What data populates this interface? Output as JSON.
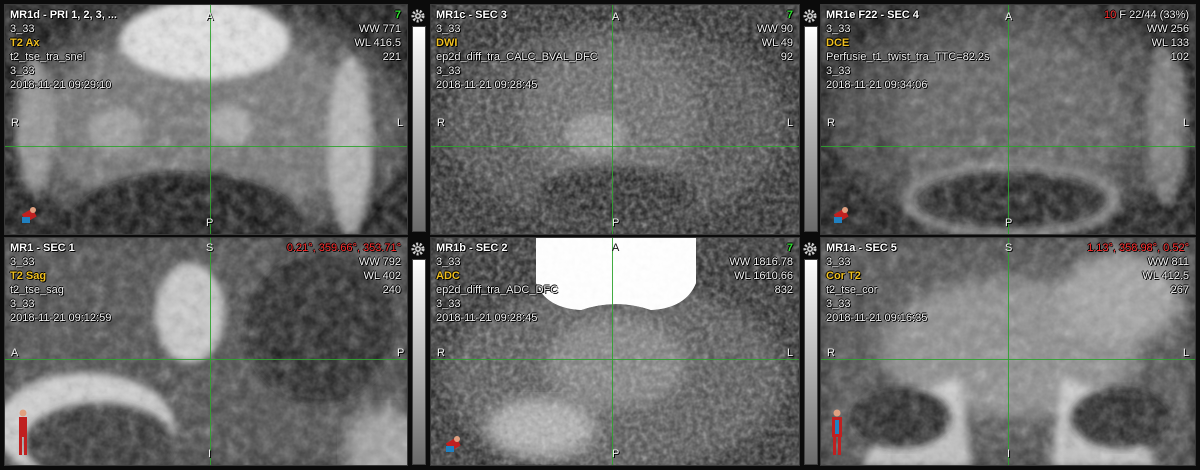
{
  "panels": [
    {
      "title": "MR1d - PRI 1, 2, 3, ...",
      "sub_label": "3_33",
      "sequence": "T2 Ax",
      "protocol": "t2_tse_tra_snel",
      "sub_label_2": "3_33",
      "datetime": "2018-11-21 09:29:10",
      "ww": "WW 771",
      "wl": "WL 416.5",
      "num": "221",
      "top_right": "7",
      "orient": {
        "top": "A",
        "bottom": "P",
        "left": "R",
        "right": "L"
      }
    },
    {
      "title": "MR1c - SEC 3",
      "sub_label": "3_33",
      "sequence": "DWI",
      "protocol": "ep2d_diff_tra_CALC_BVAL_DFC",
      "sub_label_2": "3_33",
      "datetime": "2018-11-21 09:28:45",
      "ww": "WW 90",
      "wl": "WL 49",
      "num": "92",
      "top_right": "7",
      "orient": {
        "top": "A",
        "bottom": "P",
        "left": "R",
        "right": "L"
      }
    },
    {
      "title": "MR1e F22 - SEC 4",
      "sub_label": "3_33",
      "sequence": "DCE",
      "protocol": "Perfusie_t1_twist_tra_TTC=82.2s",
      "sub_label_2": "3_33",
      "datetime": "2018-11-21 09:34:06",
      "ww": "WW 256",
      "wl": "WL 133",
      "num": "102",
      "top_right_num": "10",
      "top_right_frame": "F 22/44 (33%)",
      "orient": {
        "top": "A",
        "bottom": "P",
        "left": "R",
        "right": "L"
      }
    },
    {
      "title": "MR1 - SEC 1",
      "sub_label": "3_33",
      "sequence": "T2 Sag",
      "protocol": "t2_tse_sag",
      "sub_label_2": "3_33",
      "datetime": "2018-11-21 09:12:59",
      "ww": "WW 792",
      "wl": "WL 402",
      "num": "240",
      "top_right": "0.21°, 359.66°, 353.71°",
      "orient": {
        "top": "S",
        "bottom": "I",
        "left": "A",
        "right": "P"
      }
    },
    {
      "title": "MR1b - SEC 2",
      "sub_label": "3_33",
      "sequence": "ADC",
      "protocol": "ep2d_diff_tra_ADC_DFC",
      "sub_label_2": "3_33",
      "datetime": "2018-11-21 09:28:45",
      "ww": "WW 1816.78",
      "wl": "WL 1610.66",
      "num": "832",
      "top_right": "7",
      "orient": {
        "top": "A",
        "bottom": "P",
        "left": "R",
        "right": "L"
      }
    },
    {
      "title": "MR1a - SEC 5",
      "sub_label": "3_33",
      "sequence": "Cor T2",
      "protocol": "t2_tse_cor",
      "sub_label_2": "3_33",
      "datetime": "2018-11-21 09:16:35",
      "ww": "WW 811",
      "wl": "WL 412.5",
      "num": "267",
      "top_right": "1.13°, 358.98°, 0.52°",
      "orient": {
        "top": "S",
        "bottom": "I",
        "left": "R",
        "right": "L"
      }
    }
  ],
  "colors": {
    "title": "#ffffff",
    "sequence": "#f0c020",
    "status_green": "#2ee02e",
    "angle_red": "#ff2a2a",
    "crosshair": "#2fa32f"
  },
  "icons": [
    "gear-icon",
    "body-orientation-icon",
    "window-level-bar"
  ]
}
